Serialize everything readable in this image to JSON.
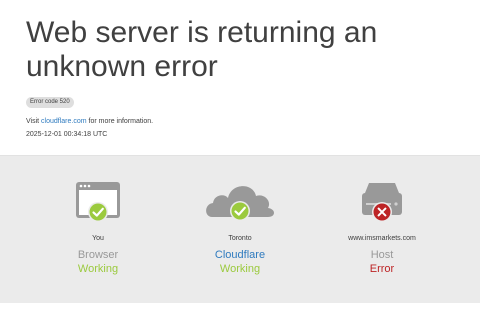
{
  "header": {
    "title": "Web server is returning an unknown error",
    "error_code": "Error code 520",
    "visit_prefix": "Visit ",
    "visit_link": "cloudflare.com",
    "visit_suffix": " for more information.",
    "timestamp": "2025-12-01 00:34:18 UTC"
  },
  "diagram": {
    "nodes": [
      {
        "who": "You",
        "role": "Browser",
        "status": "Working",
        "icon": "browser-icon",
        "state": "ok"
      },
      {
        "who": "Toronto",
        "role": "Cloudflare",
        "status": "Working",
        "icon": "cloud-icon",
        "state": "ok"
      },
      {
        "who": "www.imsmarkets.com",
        "role": "Host",
        "status": "Error",
        "icon": "server-icon",
        "state": "error"
      }
    ]
  },
  "colors": {
    "ok": "#9bca3e",
    "error": "#bd2426",
    "link": "#2f7bbf",
    "icon_gray": "#999999",
    "panel_bg": "#ebebeb"
  }
}
